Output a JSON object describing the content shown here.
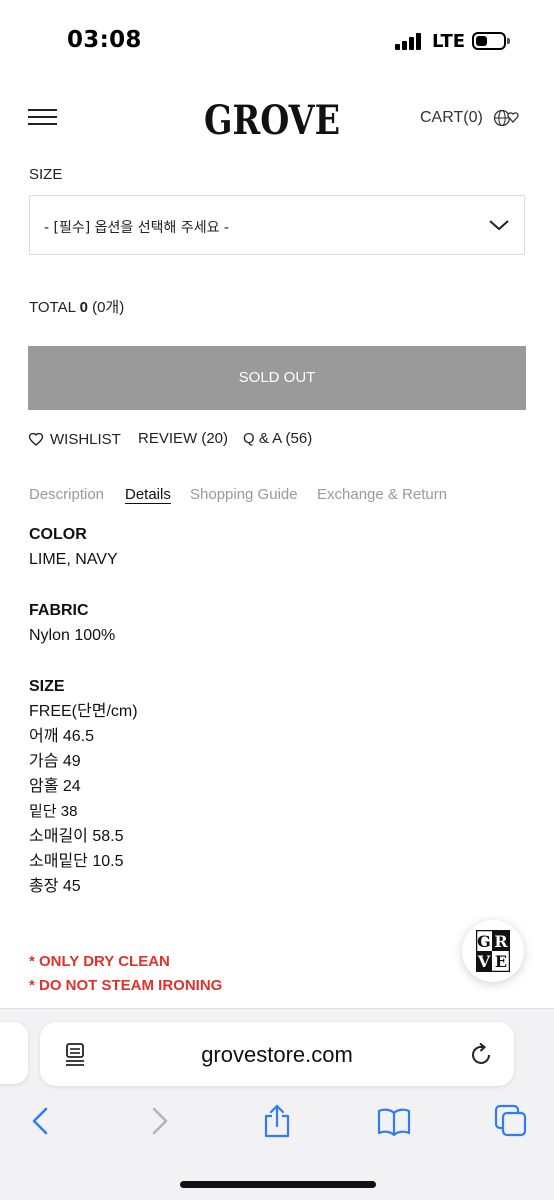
{
  "status_bar": {
    "time": "03:08",
    "network": "LTE"
  },
  "header": {
    "logo_text": "GROVE",
    "cart_label": "CART(0)"
  },
  "product": {
    "size_label": "SIZE",
    "size_select_value": "- [필수] 옵션을 선택해 주세요 -",
    "total_prefix": "TOTAL",
    "total_amount": "0",
    "total_count": "(0개)",
    "soldout_label": "SOLD OUT"
  },
  "actions": {
    "wishlist": "WISHLIST",
    "review": "REVIEW (20)",
    "qna": "Q & A (56)"
  },
  "tabs": [
    {
      "label": "Description",
      "active": false
    },
    {
      "label": "Details",
      "active": true
    },
    {
      "label": "Shopping Guide",
      "active": false
    },
    {
      "label": "Exchange & Return",
      "active": false
    }
  ],
  "details": {
    "color_title": "COLOR",
    "color_value": "LIME, NAVY",
    "fabric_title": "FABRIC",
    "fabric_value": "Nylon 100%",
    "size_title": "SIZE",
    "size_lines": [
      "FREE(단면/cm)",
      "어깨 46.5",
      "가슴 49",
      "암홀 24",
      "밑단 38",
      "소매길이 58.5",
      "소매밑단 10.5",
      "총장 45"
    ]
  },
  "notices": [
    "* ONLY DRY CLEAN",
    "* DO NOT STEAM IRONING"
  ],
  "badge": {
    "letters": [
      "G",
      "R",
      "V",
      "E"
    ]
  },
  "browser": {
    "url": "grovestore.com"
  },
  "colors": {
    "accent_red": "#e0322b",
    "soldout_gray": "#9a9a9a",
    "ios_blue": "#2f7cf6",
    "tab_inactive": "#9a9a9a"
  },
  "icons": [
    "menu-icon",
    "globe-heart-icon",
    "chevron-down-icon",
    "heart-icon",
    "page-icon",
    "reload-icon",
    "back-icon",
    "forward-icon",
    "share-icon",
    "bookmarks-icon",
    "tabs-icon"
  ]
}
